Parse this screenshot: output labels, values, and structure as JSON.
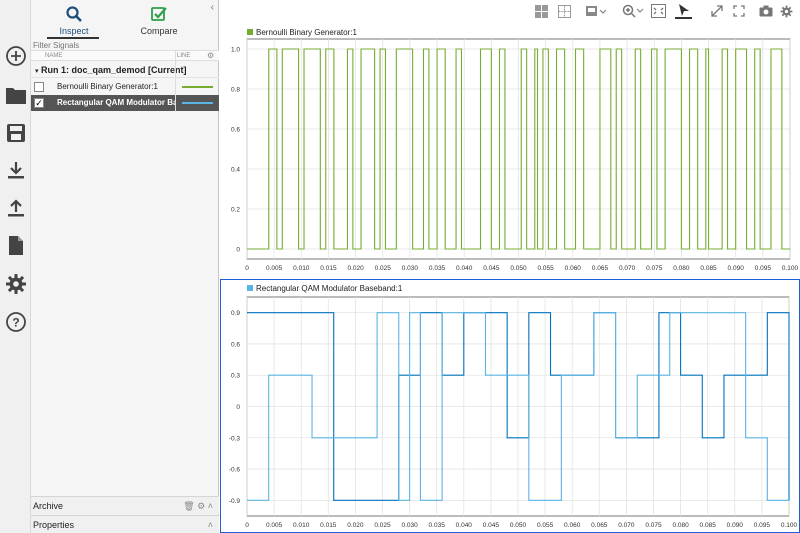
{
  "left_rail": {
    "icons": [
      "add-icon",
      "folder-icon",
      "save-icon",
      "download-icon",
      "upload-icon",
      "document-icon",
      "settings-icon",
      "help-icon"
    ]
  },
  "browser": {
    "tabs": [
      {
        "label": "Inspect",
        "icon": "magnifier-icon",
        "active": true
      },
      {
        "label": "Compare",
        "icon": "check-icon",
        "active": false
      }
    ],
    "filter_placeholder": "Filter Signals",
    "columns": {
      "name": "NAME",
      "line": "LINE"
    },
    "run_label": "Run 1: doc_qam_demod [Current]",
    "signals": [
      {
        "name": "Bernoulli Binary Generator:1",
        "checked": false,
        "selected": false,
        "line_color": "#77ac30"
      },
      {
        "name": "Rectangular QAM Modulator Bas",
        "checked": true,
        "selected": true,
        "line_color": "#5ab4e5"
      }
    ],
    "archive_label": "Archive",
    "properties_label": "Properties"
  },
  "toolbar": {
    "icons": [
      "layout-icon",
      "subplot-icon",
      "visualization-icon",
      "zoom-icon",
      "fit-icon",
      "cursor-icon",
      "expand-icon",
      "fullscreen-icon",
      "snapshot-icon",
      "settings-icon"
    ]
  },
  "colors": {
    "green": "#77ac30",
    "blue_light": "#5ab4e5",
    "blue_dark": "#0072bd",
    "selection": "#1f5ed8"
  },
  "chart_data": [
    {
      "type": "line",
      "step": true,
      "title": "Bernoulli Binary Generator:1",
      "legend": [
        "Bernoulli Binary Generator:1"
      ],
      "color": "#77ac30",
      "xlim": [
        0,
        0.1
      ],
      "ylim": [
        -0.05,
        1.05
      ],
      "xticks": [
        0,
        0.005,
        0.01,
        0.015,
        0.02,
        0.025,
        0.03,
        0.035,
        0.04,
        0.045,
        0.05,
        0.055,
        0.06,
        0.065,
        0.07,
        0.075,
        0.08,
        0.085,
        0.09,
        0.095,
        0.1
      ],
      "xtick_labels": [
        "0",
        "0.005",
        "0.010",
        "0.015",
        "0.020",
        "0.025",
        "0.030",
        "0.035",
        "0.040",
        "0.045",
        "0.050",
        "0.055",
        "0.060",
        "0.065",
        "0.070",
        "0.075",
        "0.080",
        "0.085",
        "0.090",
        "0.095",
        "0.100"
      ],
      "yticks": [
        0,
        0.2,
        0.4,
        0.6,
        0.8,
        1
      ],
      "ytick_labels": [
        "0",
        "0.2",
        "0.4",
        "0.6",
        "0.8",
        "1.0"
      ],
      "grid": true,
      "series": [
        {
          "name": "Bernoulli Binary Generator:1",
          "x": [
            0,
            0.004,
            0.0055,
            0.0065,
            0.0095,
            0.0105,
            0.0135,
            0.0145,
            0.016,
            0.0185,
            0.0195,
            0.021,
            0.0235,
            0.0245,
            0.0255,
            0.0275,
            0.0305,
            0.0325,
            0.0335,
            0.035,
            0.0365,
            0.0385,
            0.0395,
            0.043,
            0.045,
            0.0465,
            0.0475,
            0.0505,
            0.0515,
            0.053,
            0.0535,
            0.0545,
            0.0555,
            0.057,
            0.0585,
            0.0605,
            0.062,
            0.065,
            0.067,
            0.068,
            0.069,
            0.0715,
            0.0725,
            0.0745,
            0.0755,
            0.077,
            0.08,
            0.0815,
            0.083,
            0.0845,
            0.085,
            0.0875,
            0.0885,
            0.09,
            0.092,
            0.0935,
            0.0945,
            0.0965,
            0.0985,
            0.1
          ],
          "y": [
            0,
            1,
            0,
            1,
            0,
            1,
            0,
            1,
            0,
            1,
            0,
            1,
            0,
            1,
            0,
            1,
            0,
            1,
            0,
            1,
            0,
            1,
            0,
            1,
            0,
            1,
            0,
            1,
            0,
            1,
            0,
            1,
            0,
            1,
            0,
            1,
            0,
            1,
            0,
            1,
            0,
            1,
            0,
            1,
            0,
            1,
            0,
            1,
            0,
            1,
            0,
            1,
            0,
            1,
            0,
            1,
            0,
            1,
            0,
            0
          ]
        }
      ]
    },
    {
      "type": "line",
      "step": true,
      "title": "Rectangular QAM Modulator Baseband:1",
      "legend": [
        "Rectangular QAM Modulator Baseband:1"
      ],
      "xlim": [
        0,
        0.1
      ],
      "ylim": [
        -1.05,
        1.05
      ],
      "xticks": [
        0,
        0.005,
        0.01,
        0.015,
        0.02,
        0.025,
        0.03,
        0.035,
        0.04,
        0.045,
        0.05,
        0.055,
        0.06,
        0.065,
        0.07,
        0.075,
        0.08,
        0.085,
        0.09,
        0.095,
        0.1
      ],
      "xtick_labels": [
        "0",
        "0.005",
        "0.010",
        "0.015",
        "0.020",
        "0.025",
        "0.030",
        "0.035",
        "0.040",
        "0.045",
        "0.050",
        "0.055",
        "0.060",
        "0.065",
        "0.070",
        "0.075",
        "0.080",
        "0.085",
        "0.090",
        "0.095",
        "0.100"
      ],
      "yticks": [
        -0.9,
        -0.6,
        -0.3,
        0,
        0.3,
        0.6,
        0.9
      ],
      "ytick_labels": [
        "-0.9",
        "-0.6",
        "-0.3",
        "0",
        "0.3",
        "0.6",
        "0.9"
      ],
      "grid": true,
      "series": [
        {
          "name": "Rectangular QAM Modulator Baseband:1",
          "color": "#0072bd",
          "x": [
            0,
            0.012,
            0.016,
            0.028,
            0.032,
            0.036,
            0.04,
            0.048,
            0.052,
            0.056,
            0.06,
            0.064,
            0.068,
            0.072,
            0.076,
            0.08,
            0.084,
            0.088,
            0.092,
            0.096,
            0.1
          ],
          "y": [
            0.9,
            0.9,
            -0.9,
            0.3,
            0.9,
            0.3,
            0.9,
            -0.3,
            0.9,
            0.3,
            0.3,
            0.9,
            -0.3,
            -0.3,
            0.9,
            0.3,
            -0.3,
            0.3,
            0.3,
            0.9,
            -0.9
          ]
        },
        {
          "name": "Rectangular QAM Modulator Baseband:1",
          "color": "#5ab4e5",
          "x": [
            0,
            0.004,
            0.012,
            0.024,
            0.028,
            0.03,
            0.032,
            0.036,
            0.044,
            0.052,
            0.058,
            0.064,
            0.068,
            0.072,
            0.078,
            0.092,
            0.096,
            0.1
          ],
          "y": [
            -0.9,
            0.3,
            -0.3,
            0.9,
            -0.9,
            0.9,
            -0.9,
            0.9,
            0.3,
            -0.9,
            0.3,
            0.9,
            -0.3,
            0.3,
            0.9,
            -0.3,
            -0.9,
            -0.9
          ]
        }
      ]
    }
  ]
}
